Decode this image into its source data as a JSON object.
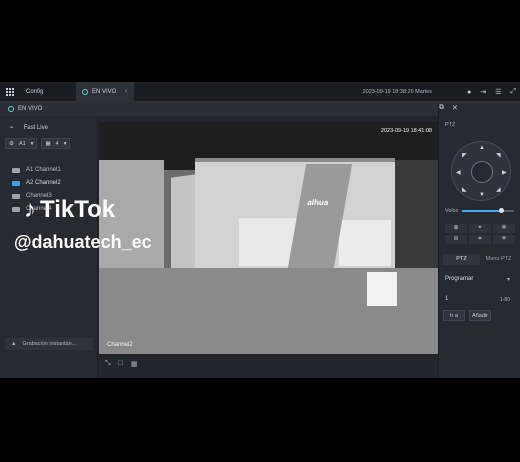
{
  "window": {
    "tabs": [
      {
        "label": "Config"
      },
      {
        "label": "EN VIVO"
      }
    ],
    "clock": "2023-09-19 18:38:26 Martes"
  },
  "subbar": {
    "title": "EN VIVO"
  },
  "left_panel": {
    "fast_live": "Fast Live",
    "stream_selector": "A1",
    "layout_selector": "4",
    "channels": [
      {
        "label": "A1 Channel1"
      },
      {
        "label": "A2 Channel2"
      },
      {
        "label": "Channel3"
      },
      {
        "label": "Channel4"
      }
    ],
    "instant_record": "Grabación instantán..."
  },
  "video": {
    "timestamp_osd": "2023-09-19 18:41:08",
    "channel_osd": "Channel2",
    "logo_text": "alhua"
  },
  "ptz": {
    "title": "PTZ",
    "speed_label": "Veloc",
    "speed_level": 0.75,
    "tabs": [
      "PTZ",
      "Menú PTZ"
    ],
    "program_label": "Programar",
    "preset_value": "1",
    "preset_range": "1-80",
    "go_button": "Ir a",
    "add_button": "Añadir"
  },
  "overlay": {
    "brand": "TikTok",
    "handle": "@dahuatech_ec"
  }
}
